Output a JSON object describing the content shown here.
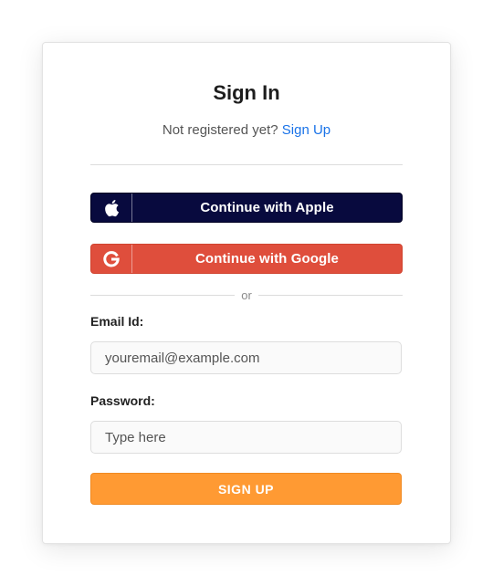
{
  "header": {
    "title": "Sign In",
    "subtitle_text": "Not registered yet?",
    "signup_link": "Sign Up"
  },
  "social": {
    "apple_label": "Continue with Apple",
    "apple_icon": "apple-icon",
    "apple_color": "#080a3e",
    "google_label": "Continue with Google",
    "google_icon": "google-icon",
    "google_color": "#df4e3c"
  },
  "separator": {
    "text": "or"
  },
  "form": {
    "email_label": "Email Id:",
    "email_value": "",
    "email_placeholder": "youremail@example.com",
    "password_label": "Password:",
    "password_value": "",
    "password_placeholder": "Type here",
    "submit_label": "SIGN UP",
    "submit_color": "#ff9a33"
  },
  "colors": {
    "link": "#1a73e8"
  }
}
